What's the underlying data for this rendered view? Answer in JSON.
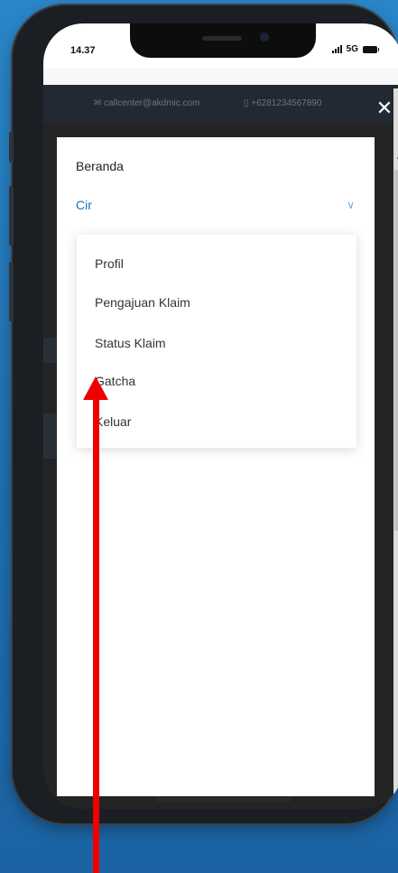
{
  "status_bar": {
    "time": "14.37",
    "network": "5G"
  },
  "site_topbar": {
    "email": "✉ callcenter@akdmic.com",
    "phone": "▯ +6281234567890"
  },
  "menu": {
    "title": "Beranda",
    "selected_label": "Cir",
    "items": [
      "Profil",
      "Pengajuan Klaim",
      "Status Klaim",
      "Gatcha",
      "Keluar"
    ]
  },
  "colors": {
    "accent": "#1a73c8",
    "annotation_arrow": "#ee0000",
    "background": "#1f6fb0"
  },
  "icons": {
    "close": "close-icon",
    "chevron": "chevron-down-icon"
  }
}
